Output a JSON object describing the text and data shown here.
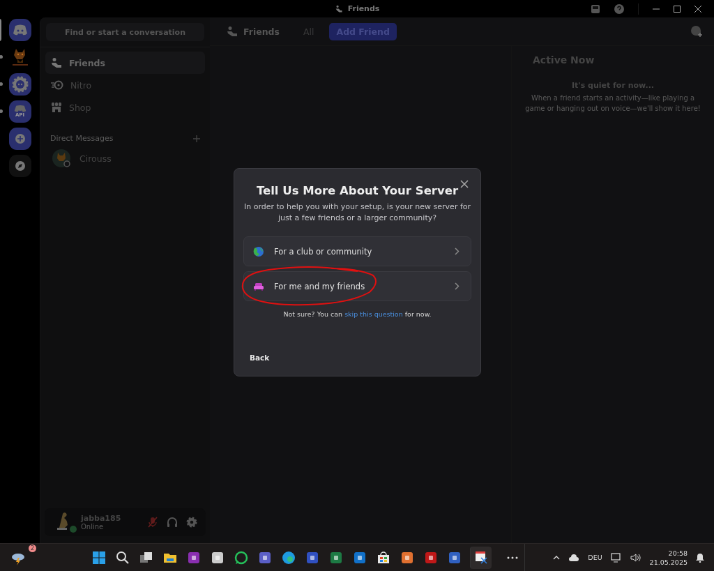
{
  "window": {
    "title": "Friends"
  },
  "servers": [
    {
      "kind": "home",
      "selected": true,
      "unread": false
    },
    {
      "kind": "image",
      "selected": false,
      "unread": true
    },
    {
      "kind": "bot",
      "selected": false,
      "unread": true
    },
    {
      "kind": "api",
      "label": "API",
      "selected": false,
      "unread": true
    },
    {
      "kind": "add",
      "selected": false,
      "unread": false
    },
    {
      "kind": "discover",
      "selected": false,
      "unread": false
    }
  ],
  "search": {
    "placeholder": "Find or start a conversation"
  },
  "nav": [
    {
      "label": "Friends",
      "kind": "friends",
      "selected": true
    },
    {
      "label": "Nitro",
      "kind": "nitro",
      "selected": false
    },
    {
      "label": "Shop",
      "kind": "shop",
      "selected": false
    }
  ],
  "direct_messages": {
    "heading": "Direct Messages",
    "items": [
      {
        "name": "Cirouss"
      }
    ]
  },
  "user": {
    "name": "jabba185",
    "status": "Online",
    "mic_muted": true
  },
  "header_tabs": [
    {
      "label": "Friends",
      "kind": "title"
    },
    {
      "label": "All",
      "kind": "tab"
    },
    {
      "label": "Add Friend",
      "kind": "add"
    }
  ],
  "active_now": {
    "title": "Active Now",
    "empty_title": "It's quiet for now...",
    "empty_text": "When a friend starts an activity—like playing a game or hanging out on voice—we'll show it here!"
  },
  "modal": {
    "title": "Tell Us More About Your Server",
    "subtitle": "In order to help you with your setup, is your new server for just a few friends or a larger community?",
    "options": [
      {
        "label": "For a club or community",
        "kind": "globe"
      },
      {
        "label": "For me and my friends",
        "kind": "couch"
      }
    ],
    "hint_before": "Not sure? You can",
    "hint_link": "skip this question",
    "hint_after": "for now.",
    "back": "Back"
  },
  "taskbar": {
    "weather_badge": "2",
    "apps": [
      {
        "kind": "start",
        "active": false
      },
      {
        "kind": "search",
        "active": false
      },
      {
        "kind": "taskview",
        "active": false
      },
      {
        "kind": "folder",
        "active": false
      },
      {
        "kind": "notes",
        "active": false
      },
      {
        "kind": "inkscape",
        "active": false
      },
      {
        "kind": "chat",
        "active": false
      },
      {
        "kind": "teams",
        "active": false
      },
      {
        "kind": "edge",
        "active": false
      },
      {
        "kind": "remote",
        "active": false
      },
      {
        "kind": "sheet",
        "active": false
      },
      {
        "kind": "mail",
        "active": false
      },
      {
        "kind": "store",
        "active": false
      },
      {
        "kind": "player",
        "active": false
      },
      {
        "kind": "ftp",
        "active": false
      },
      {
        "kind": "network",
        "active": false
      },
      {
        "kind": "snip",
        "active": true
      }
    ],
    "language": "DEU",
    "time": "20:58",
    "date": "21.05.2025"
  }
}
